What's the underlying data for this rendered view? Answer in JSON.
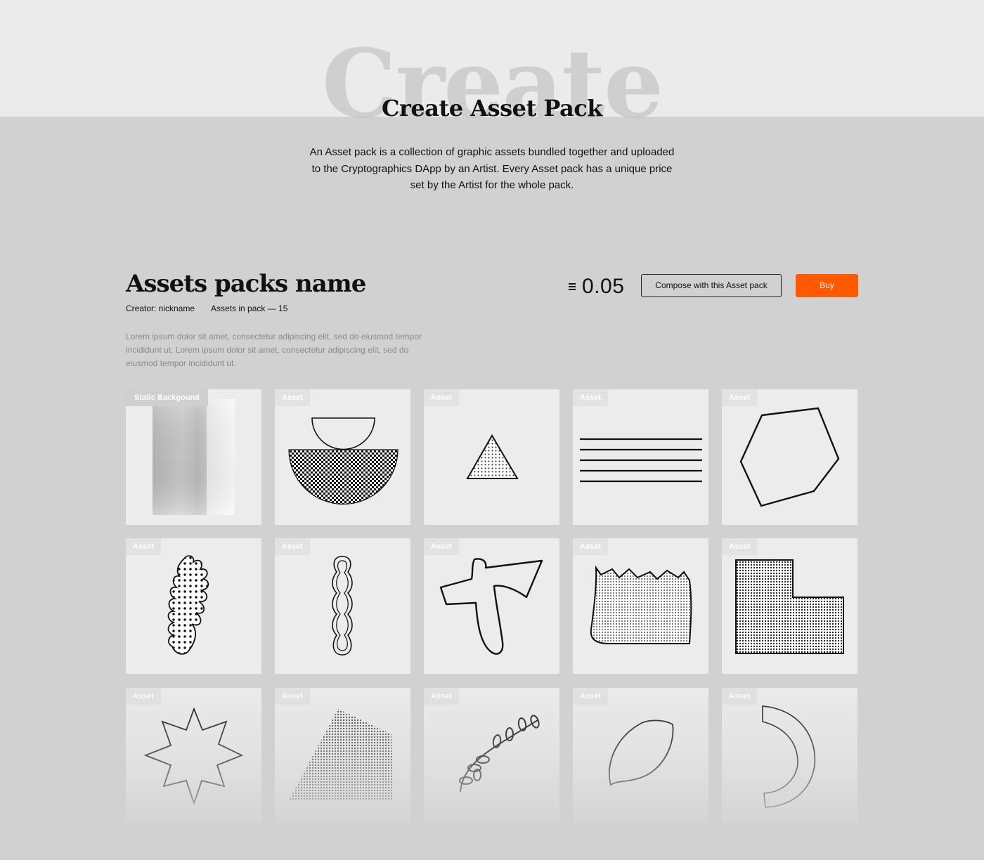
{
  "hero": {
    "watermark": "Create",
    "title": "Create Asset Pack",
    "intro": "An Asset pack is a collection of graphic assets bundled together and uploaded to the Cryptographics DApp by an Artist. Every Asset pack has a unique price set by the Artist for the whole pack."
  },
  "pack": {
    "name": "Assets packs name",
    "creator": "Creator: nickname",
    "count": "Assets in pack — 15",
    "description": "Lorem ipsum dolor sit amet, consectetur adipiscing elit, sed do eiusmod tempor incididunt ut. Lorem ipsum dolor sit amet, consectetur adipiscing elit, sed do eiusmod tempor incididunt ut.",
    "price": "0.05",
    "currency_icon": "eth-icon",
    "compose_label": "Compose with this Asset pack",
    "buy_label": "Buy"
  },
  "colors": {
    "accent": "#ff5a00",
    "background": "#d1d1d1",
    "tile": "#ececec"
  },
  "assets": [
    {
      "tag": "Static Backgound",
      "icon": "static-background-texture"
    },
    {
      "tag": "Asset",
      "icon": "bowl-semicircle-shape"
    },
    {
      "tag": "Asset",
      "icon": "triangle-shape"
    },
    {
      "tag": "Asset",
      "icon": "horizontal-lines-shape"
    },
    {
      "tag": "Asset",
      "icon": "hexagon-shape"
    },
    {
      "tag": "Asset",
      "icon": "leaf-blob-shape"
    },
    {
      "tag": "Asset",
      "icon": "wavy-loop-shape"
    },
    {
      "tag": "Asset",
      "icon": "axe-shape"
    },
    {
      "tag": "Asset",
      "icon": "torn-paper-shape"
    },
    {
      "tag": "Asset",
      "icon": "l-shape"
    },
    {
      "tag": "Asset",
      "icon": "star-shape"
    },
    {
      "tag": "Asset",
      "icon": "dotted-quad-shape"
    },
    {
      "tag": "Asset",
      "icon": "branch-shape"
    },
    {
      "tag": "Asset",
      "icon": "leaf-shape"
    },
    {
      "tag": "Asset",
      "icon": "arc-shape"
    }
  ]
}
